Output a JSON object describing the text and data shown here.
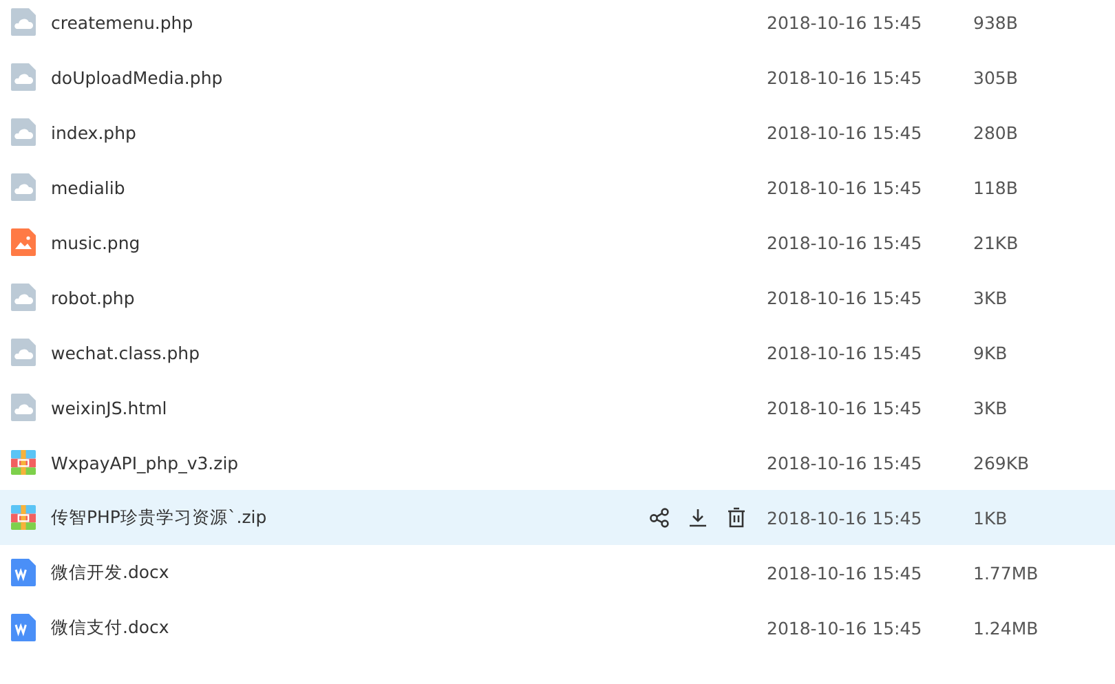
{
  "files": [
    {
      "kind": "cloud",
      "name": "createmenu.php",
      "date": "2018-10-16 15:45",
      "size": "938B",
      "selected": false
    },
    {
      "kind": "cloud",
      "name": "doUploadMedia.php",
      "date": "2018-10-16 15:45",
      "size": "305B",
      "selected": false
    },
    {
      "kind": "cloud",
      "name": "index.php",
      "date": "2018-10-16 15:45",
      "size": "280B",
      "selected": false
    },
    {
      "kind": "cloud",
      "name": "medialib",
      "date": "2018-10-16 15:45",
      "size": "118B",
      "selected": false
    },
    {
      "kind": "image",
      "name": "music.png",
      "date": "2018-10-16 15:45",
      "size": "21KB",
      "selected": false
    },
    {
      "kind": "cloud",
      "name": "robot.php",
      "date": "2018-10-16 15:45",
      "size": "3KB",
      "selected": false
    },
    {
      "kind": "cloud",
      "name": "wechat.class.php",
      "date": "2018-10-16 15:45",
      "size": "9KB",
      "selected": false
    },
    {
      "kind": "cloud",
      "name": "weixinJS.html",
      "date": "2018-10-16 15:45",
      "size": "3KB",
      "selected": false
    },
    {
      "kind": "zip",
      "name": "WxpayAPI_php_v3.zip",
      "date": "2018-10-16 15:45",
      "size": "269KB",
      "selected": false
    },
    {
      "kind": "zip",
      "name": "传智PHP珍贵学习资源`.zip",
      "date": "2018-10-16 15:45",
      "size": "1KB",
      "selected": true
    },
    {
      "kind": "word",
      "name": "微信开发.docx",
      "date": "2018-10-16 15:45",
      "size": "1.77MB",
      "selected": false
    },
    {
      "kind": "word",
      "name": "微信支付.docx",
      "date": "2018-10-16 15:45",
      "size": "1.24MB",
      "selected": false
    }
  ]
}
